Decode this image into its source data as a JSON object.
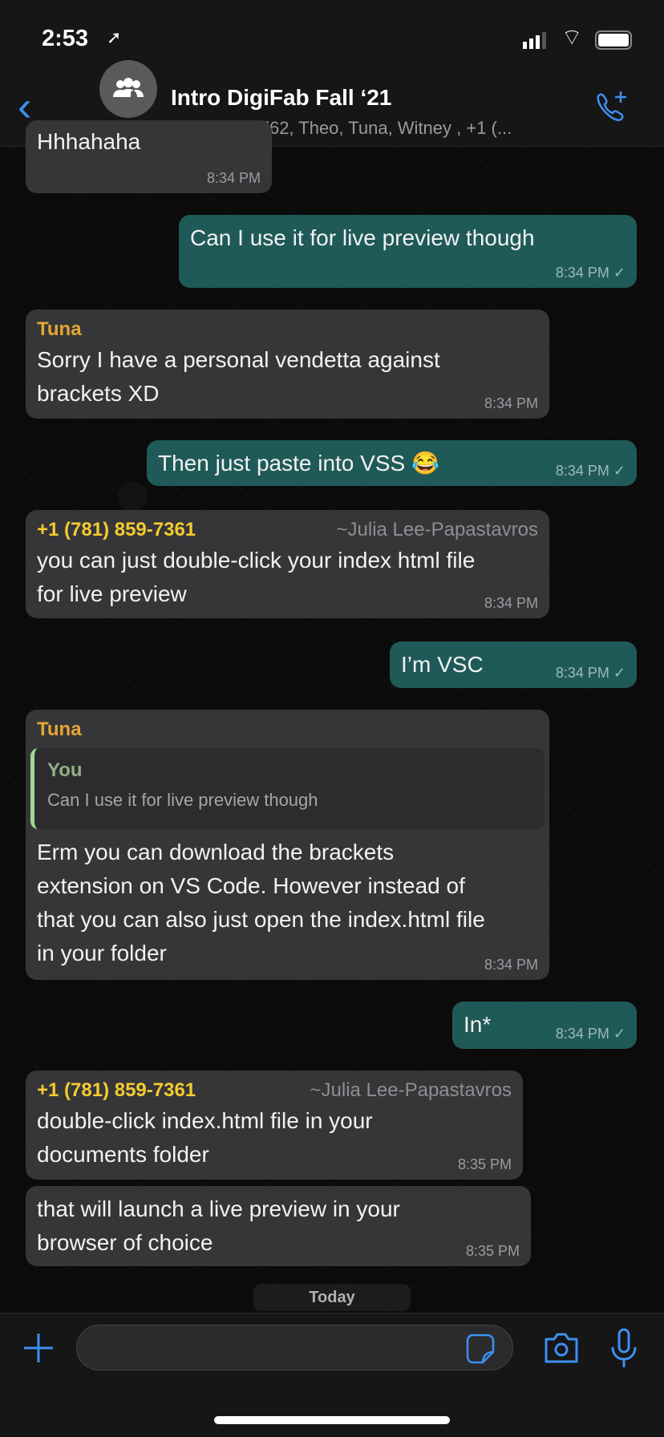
{
  "status_bar": {
    "time": "2:53"
  },
  "header": {
    "back": "‹",
    "title": "Intro DigiFab Fall ‘21",
    "subtitle": "+17049756762, Theo, Tuna, Witney , +1 (..."
  },
  "messages": [
    {
      "dir": "in",
      "text": "Hhhahaha",
      "time": "8:34 PM"
    },
    {
      "dir": "out",
      "text": "Can I use it for live preview though",
      "time": "8:34 PM ✓"
    },
    {
      "dir": "in",
      "sender": "Tuna",
      "text": "Sorry I have a personal vendetta against brackets XD",
      "time": "8:34 PM"
    },
    {
      "dir": "out",
      "text": "Then just paste into VSS 😂",
      "time": "8:34 PM ✓"
    },
    {
      "dir": "in",
      "sender": "+1 (781) 859-7361",
      "alias": "~Julia Lee-Papastavros",
      "text": "you can just double-click your index html file for live preview",
      "time": "8:34 PM"
    },
    {
      "dir": "out",
      "text": "I’m VSC",
      "time": "8:34 PM ✓"
    },
    {
      "dir": "in",
      "sender": "Tuna",
      "quote_name": "You",
      "quote_text": "Can I use it for live preview though",
      "text": "Erm you can download the brackets extension on VS Code. However instead of that you can also just open the index.html file in your folder",
      "time": "8:34 PM"
    },
    {
      "dir": "out",
      "text": "In*",
      "time": "8:34 PM ✓"
    },
    {
      "dir": "in",
      "sender": "+1 (781) 859-7361",
      "alias": "~Julia Lee-Papastavros",
      "text": "double-click index.html file in your documents folder",
      "time": "8:35 PM"
    },
    {
      "dir": "in",
      "text": "that will launch a live preview in your browser of choice",
      "time": "8:35 PM"
    }
  ],
  "date_divider": "Today",
  "colors": {
    "accent": "#3d8ff0",
    "outgoing": "#1f5a58",
    "incoming": "#363638",
    "sender_tuna": "#e5a634",
    "sender_phone": "#f3cc2e"
  }
}
